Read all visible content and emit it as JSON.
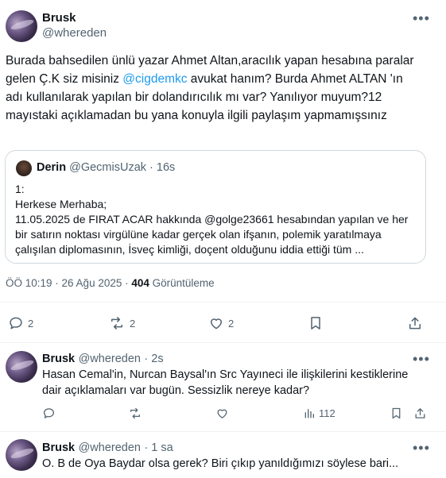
{
  "main_tweet": {
    "author_name": "Brusk",
    "author_handle": "@whereden",
    "text_before": "Burada bahsedilen ünlü yazar Ahmet Altan,aracılık yapan hesabına paralar gelen Ç.K siz misiniz ",
    "mention": "@cigdemkc",
    "text_after": " avukat hanım? Burda Ahmet ALTAN 'ın adı kullanılarak yapılan bir dolandırıcılık mı var? Yanılıyor muyum?12 mayıstaki açıklamadan bu yana konuyla ilgili paylaşım yapmamışsınız",
    "quote": {
      "author_name": "Derin",
      "author_handle": "@GecmisUzak",
      "time": "· 16s",
      "text": "1:\nHerkese Merhaba;\n11.05.2025 de FIRAT ACAR hakkında @golge23661 hesabından yapılan ve her bir satırın noktası virgülüne kadar gerçek olan ifşanın, polemik yaratılmaya çalışılan diplomasının, İsveç kimliği, doçent olduğunu iddia ettiği tüm ..."
    },
    "timestamp": "ÖÖ 10:19 · 26 Ağu 2025 · ",
    "views_count": "404",
    "views_label": " Görüntüleme",
    "actions": {
      "replies": "2",
      "reposts": "2",
      "likes": "2"
    }
  },
  "replies": [
    {
      "author_name": "Brusk",
      "author_handle": "@whereden",
      "time": "· 2s",
      "text": "Hasan Cemal'in, Nurcan Baysal'ın Src Yayıneci ile ilişkilerini kestiklerine dair açıklamaları var bugün. Sessizlik nereye kadar?",
      "views": "112"
    },
    {
      "author_name": "Brusk",
      "author_handle": "@whereden",
      "time": "· 1 sa",
      "text": "O. B de Oya Baydar olsa gerek? Biri çıkıp yanıldığımızı söylese bari..."
    }
  ],
  "icons": [
    "more-icon",
    "reply-icon",
    "repost-icon",
    "like-icon",
    "bookmark-icon",
    "share-icon",
    "views-icon"
  ]
}
